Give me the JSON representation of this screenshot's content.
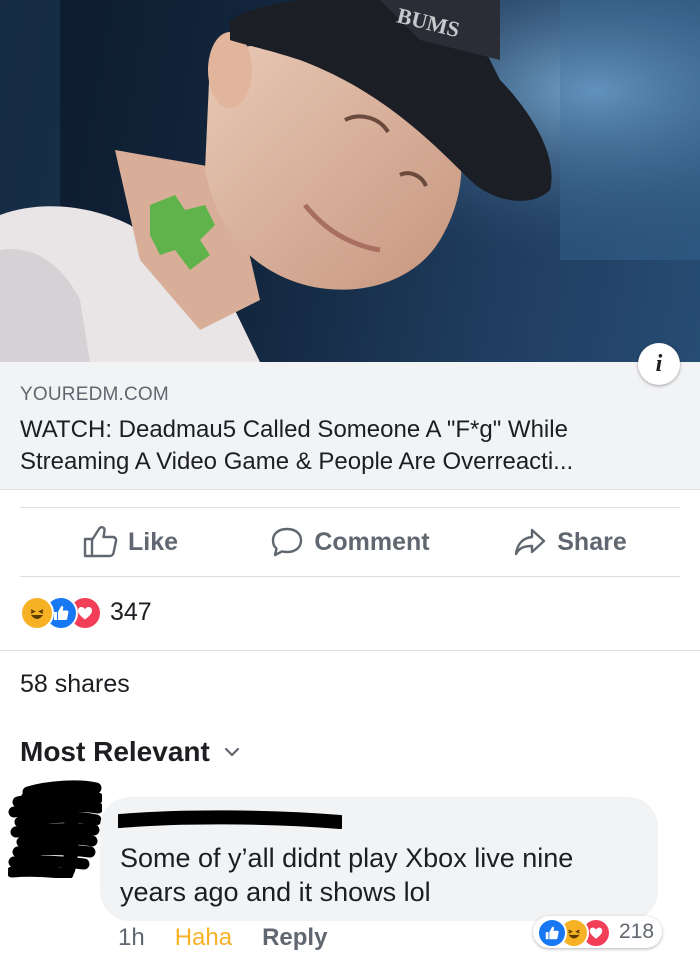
{
  "link_preview": {
    "domain": "YOUREDM.COM",
    "title": "WATCH: Deadmau5 Called Someone A \"F*g\" While Streaming A Video Game & People Are Overreacti..."
  },
  "actions": {
    "like": "Like",
    "comment": "Comment",
    "share": "Share"
  },
  "reactions": {
    "icons": [
      "haha-icon",
      "like-icon",
      "love-icon"
    ],
    "count": "347"
  },
  "shares": "58 shares",
  "sort_label": "Most Relevant",
  "comment": {
    "text": "Some of y’all didnt play Xbox live  nine years ago and it shows lol",
    "time": "1h",
    "reaction_given": "Haha",
    "reply_label": "Reply",
    "reaction_icons": [
      "like-icon",
      "haha-icon",
      "love-icon"
    ],
    "reaction_count": "218"
  },
  "colors": {
    "like_blue": "#1877f2",
    "love_red": "#f33e58",
    "haha_yellow": "#f7b125",
    "secondary_text": "#606770"
  }
}
